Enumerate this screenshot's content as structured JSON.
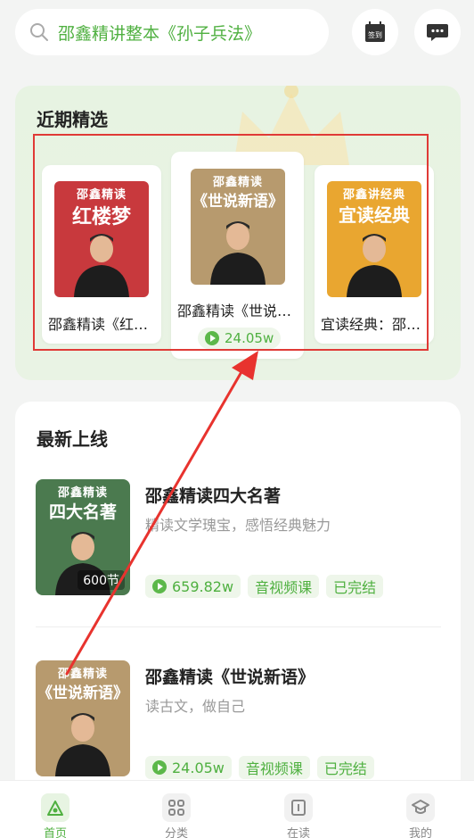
{
  "search": {
    "placeholder": "邵鑫精讲整本《孙子兵法》"
  },
  "header": {
    "sign_label": "签到"
  },
  "featured": {
    "title": "近期精选",
    "cards": [
      {
        "title": "邵鑫精读《红…",
        "cover_top": "邵鑫精读",
        "cover_big": "红楼梦"
      },
      {
        "title": "邵鑫精读《世说…",
        "cover_top": "邵鑫精读",
        "cover_big": "《世说新语》",
        "plays": "24.05w"
      },
      {
        "title": "宜读经典：邵…",
        "cover_top": "邵鑫讲经典",
        "cover_big": "宜读经典"
      }
    ]
  },
  "latest": {
    "title": "最新上线",
    "items": [
      {
        "cover_top": "邵鑫精读",
        "cover_big": "四大名著",
        "badge": "600节",
        "name": "邵鑫精读四大名著",
        "desc": "精读文学瑰宝，感悟经典魅力",
        "plays": "659.82w",
        "tag1": "音视频课",
        "tag2": "已完结"
      },
      {
        "cover_top": "邵鑫精读",
        "cover_big": "《世说新语》",
        "name": "邵鑫精读《世说新语》",
        "desc": "读古文，做自己",
        "plays": "24.05w",
        "tag1": "音视频课",
        "tag2": "已完结"
      }
    ]
  },
  "nav": [
    {
      "label": "首页",
      "icon": "home-icon",
      "active": true
    },
    {
      "label": "分类",
      "icon": "grid-icon"
    },
    {
      "label": "在读",
      "icon": "book-icon"
    },
    {
      "label": "我的",
      "icon": "graduation-cap-icon"
    }
  ],
  "colors": {
    "accent": "#4fb040",
    "highlight": "#e03a36",
    "red_cover": "#c8393d",
    "tan_cover": "#b79a6e",
    "orange_cover": "#e9a630",
    "green_cover": "#4b7a4f"
  }
}
